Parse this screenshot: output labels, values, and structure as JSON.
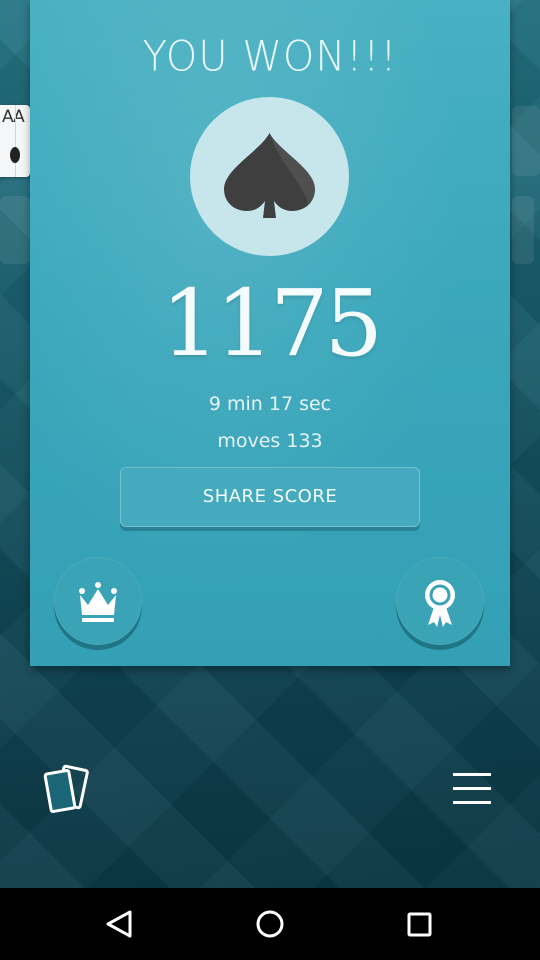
{
  "win_panel": {
    "title": "YOU WON!!!",
    "score": "1175",
    "time": "9 min 17 sec",
    "moves": "moves 133",
    "share_label": "SHARE SCORE"
  },
  "peek_card": {
    "rank": "AA"
  },
  "icons": {
    "suit": "spade-icon",
    "leaderboard": "crown-icon",
    "achievements": "ribbon-award-icon",
    "new_game": "cards-icon",
    "menu": "hamburger-menu-icon",
    "nav_back": "back-triangle-icon",
    "nav_home": "home-circle-icon",
    "nav_recent": "recent-apps-square-icon"
  },
  "colors": {
    "panel": "#3aa7bb",
    "suit_circle": "#c7e6ec",
    "spade": "#3f3f3f",
    "background": "#145c6d",
    "text": "#eaf7fa"
  }
}
